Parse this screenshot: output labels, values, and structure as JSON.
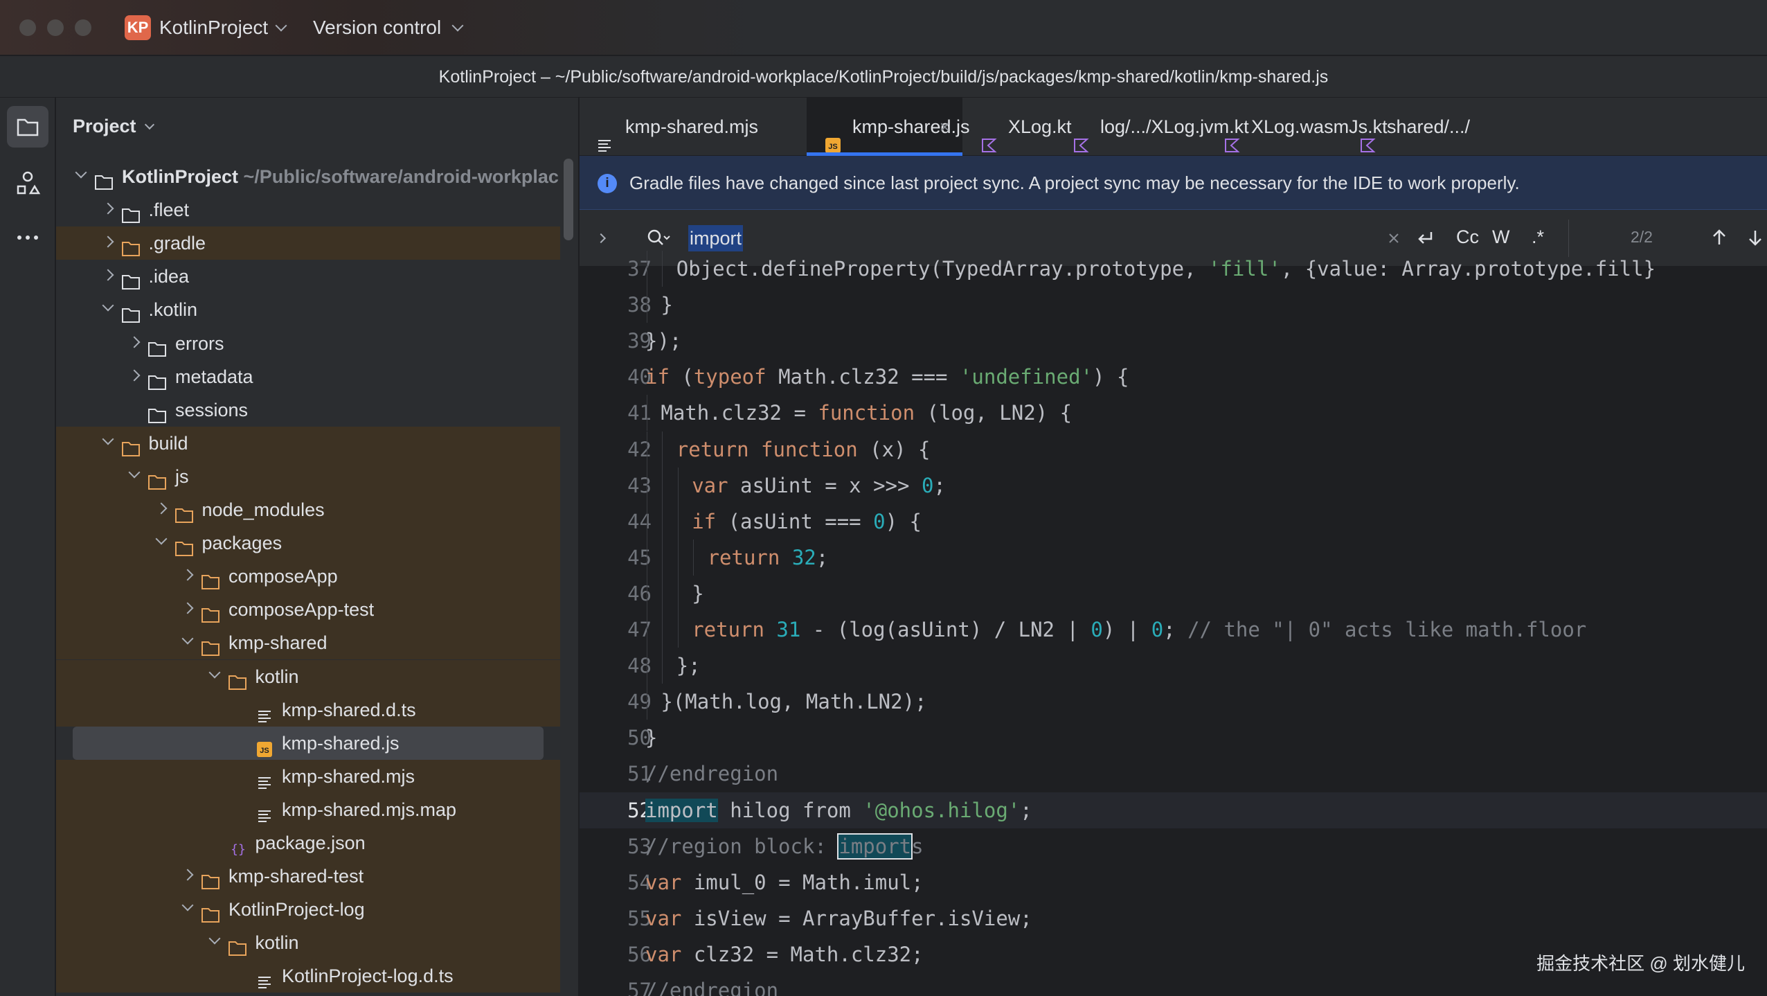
{
  "window": {
    "project_badge": "KP",
    "project_name": "KotlinProject",
    "vcs_label": "Version control",
    "path": "KotlinProject – ~/Public/software/android-workplace/KotlinProject/build/js/packages/kmp-shared/kotlin/kmp-shared.js"
  },
  "project_panel": {
    "title": "Project",
    "tree": [
      {
        "label": "KotlinProject",
        "hint": "~/Public/software/android-workplac",
        "depth": 0,
        "chevron": "down",
        "icon": "module",
        "bold": true
      },
      {
        "label": ".fleet",
        "depth": 1,
        "chevron": "right",
        "icon": "folder"
      },
      {
        "label": ".gradle",
        "depth": 1,
        "chevron": "right",
        "icon": "folder-orange",
        "highlight": true
      },
      {
        "label": ".idea",
        "depth": 1,
        "chevron": "right",
        "icon": "folder"
      },
      {
        "label": ".kotlin",
        "depth": 1,
        "chevron": "down",
        "icon": "folder"
      },
      {
        "label": "errors",
        "depth": 2,
        "chevron": "right",
        "icon": "folder"
      },
      {
        "label": "metadata",
        "depth": 2,
        "chevron": "right",
        "icon": "folder"
      },
      {
        "label": "sessions",
        "depth": 2,
        "chevron": "none",
        "icon": "folder"
      },
      {
        "label": "build",
        "depth": 1,
        "chevron": "down",
        "icon": "folder-orange",
        "highlight": true
      },
      {
        "label": "js",
        "depth": 2,
        "chevron": "down",
        "icon": "folder-orange",
        "highlight": true
      },
      {
        "label": "node_modules",
        "depth": 3,
        "chevron": "right",
        "icon": "folder-orange",
        "highlight": true
      },
      {
        "label": "packages",
        "depth": 3,
        "chevron": "down",
        "icon": "folder-orange",
        "highlight": true
      },
      {
        "label": "composeApp",
        "depth": 4,
        "chevron": "right",
        "icon": "folder-orange",
        "highlight": true
      },
      {
        "label": "composeApp-test",
        "depth": 4,
        "chevron": "right",
        "icon": "folder-orange",
        "highlight": true
      },
      {
        "label": "kmp-shared",
        "depth": 4,
        "chevron": "down",
        "icon": "folder-orange",
        "highlight": true
      },
      {
        "label": "kotlin",
        "depth": 5,
        "chevron": "down",
        "icon": "folder-orange",
        "highlight": true
      },
      {
        "label": "kmp-shared.d.ts",
        "depth": 6,
        "chevron": "none",
        "icon": "text-file",
        "highlight": true
      },
      {
        "label": "kmp-shared.js",
        "depth": 6,
        "chevron": "none",
        "icon": "js-file",
        "selected": true
      },
      {
        "label": "kmp-shared.mjs",
        "depth": 6,
        "chevron": "none",
        "icon": "text-file",
        "highlight": true
      },
      {
        "label": "kmp-shared.mjs.map",
        "depth": 6,
        "chevron": "none",
        "icon": "text-file",
        "highlight": true
      },
      {
        "label": "package.json",
        "depth": 5,
        "chevron": "none",
        "icon": "json-file",
        "highlight": true
      },
      {
        "label": "kmp-shared-test",
        "depth": 4,
        "chevron": "right",
        "icon": "folder-orange",
        "highlight": true
      },
      {
        "label": "KotlinProject-log",
        "depth": 4,
        "chevron": "down",
        "icon": "folder-orange",
        "highlight": true
      },
      {
        "label": "kotlin",
        "depth": 5,
        "chevron": "down",
        "icon": "folder-orange",
        "highlight": true
      },
      {
        "label": "KotlinProject-log.d.ts",
        "depth": 6,
        "chevron": "none",
        "icon": "text-file",
        "highlight": true
      }
    ]
  },
  "tabs": [
    {
      "label": "kmp-shared.mjs",
      "icon": "text-file",
      "active": false
    },
    {
      "label": "kmp-shared.js",
      "icon": "js-file",
      "active": true
    },
    {
      "label": "XLog.kt",
      "icon": "kotlin-file",
      "active": false
    },
    {
      "label": "log/.../XLog.jvm.kt",
      "icon": "kotlin-file",
      "active": false
    },
    {
      "label": "XLog.wasmJs.kt",
      "icon": "kotlin-file",
      "active": false
    },
    {
      "label": "shared/.../",
      "icon": "kotlin-file",
      "active": false
    }
  ],
  "notice": {
    "text": "Gradle files have changed since last project sync. A project sync may be necessary for the IDE to work properly."
  },
  "find": {
    "query": "import",
    "opt_case": "Cc",
    "opt_word": "W",
    "opt_regex": ".*",
    "count": "2/2"
  },
  "code": {
    "current_line": 52,
    "lines": [
      {
        "n": "37",
        "indent": 2
      },
      {
        "n": "38",
        "indent": 1
      },
      {
        "n": "39",
        "indent": 0
      },
      {
        "n": "40",
        "indent": 0
      },
      {
        "n": "41",
        "indent": 1
      },
      {
        "n": "42",
        "indent": 2
      },
      {
        "n": "43",
        "indent": 3
      },
      {
        "n": "44",
        "indent": 3
      },
      {
        "n": "45",
        "indent": 4
      },
      {
        "n": "46",
        "indent": 3
      },
      {
        "n": "47",
        "indent": 3
      },
      {
        "n": "48",
        "indent": 2
      },
      {
        "n": "49",
        "indent": 1
      },
      {
        "n": "50",
        "indent": 0
      },
      {
        "n": "51",
        "indent": 0
      },
      {
        "n": "52",
        "indent": 0
      },
      {
        "n": "53",
        "indent": 0
      },
      {
        "n": "54",
        "indent": 0
      },
      {
        "n": "55",
        "indent": 0
      },
      {
        "n": "56",
        "indent": 0
      },
      {
        "n": "57",
        "indent": 0
      }
    ]
  },
  "watermark": "掘金技术社区 @ 划水健儿"
}
